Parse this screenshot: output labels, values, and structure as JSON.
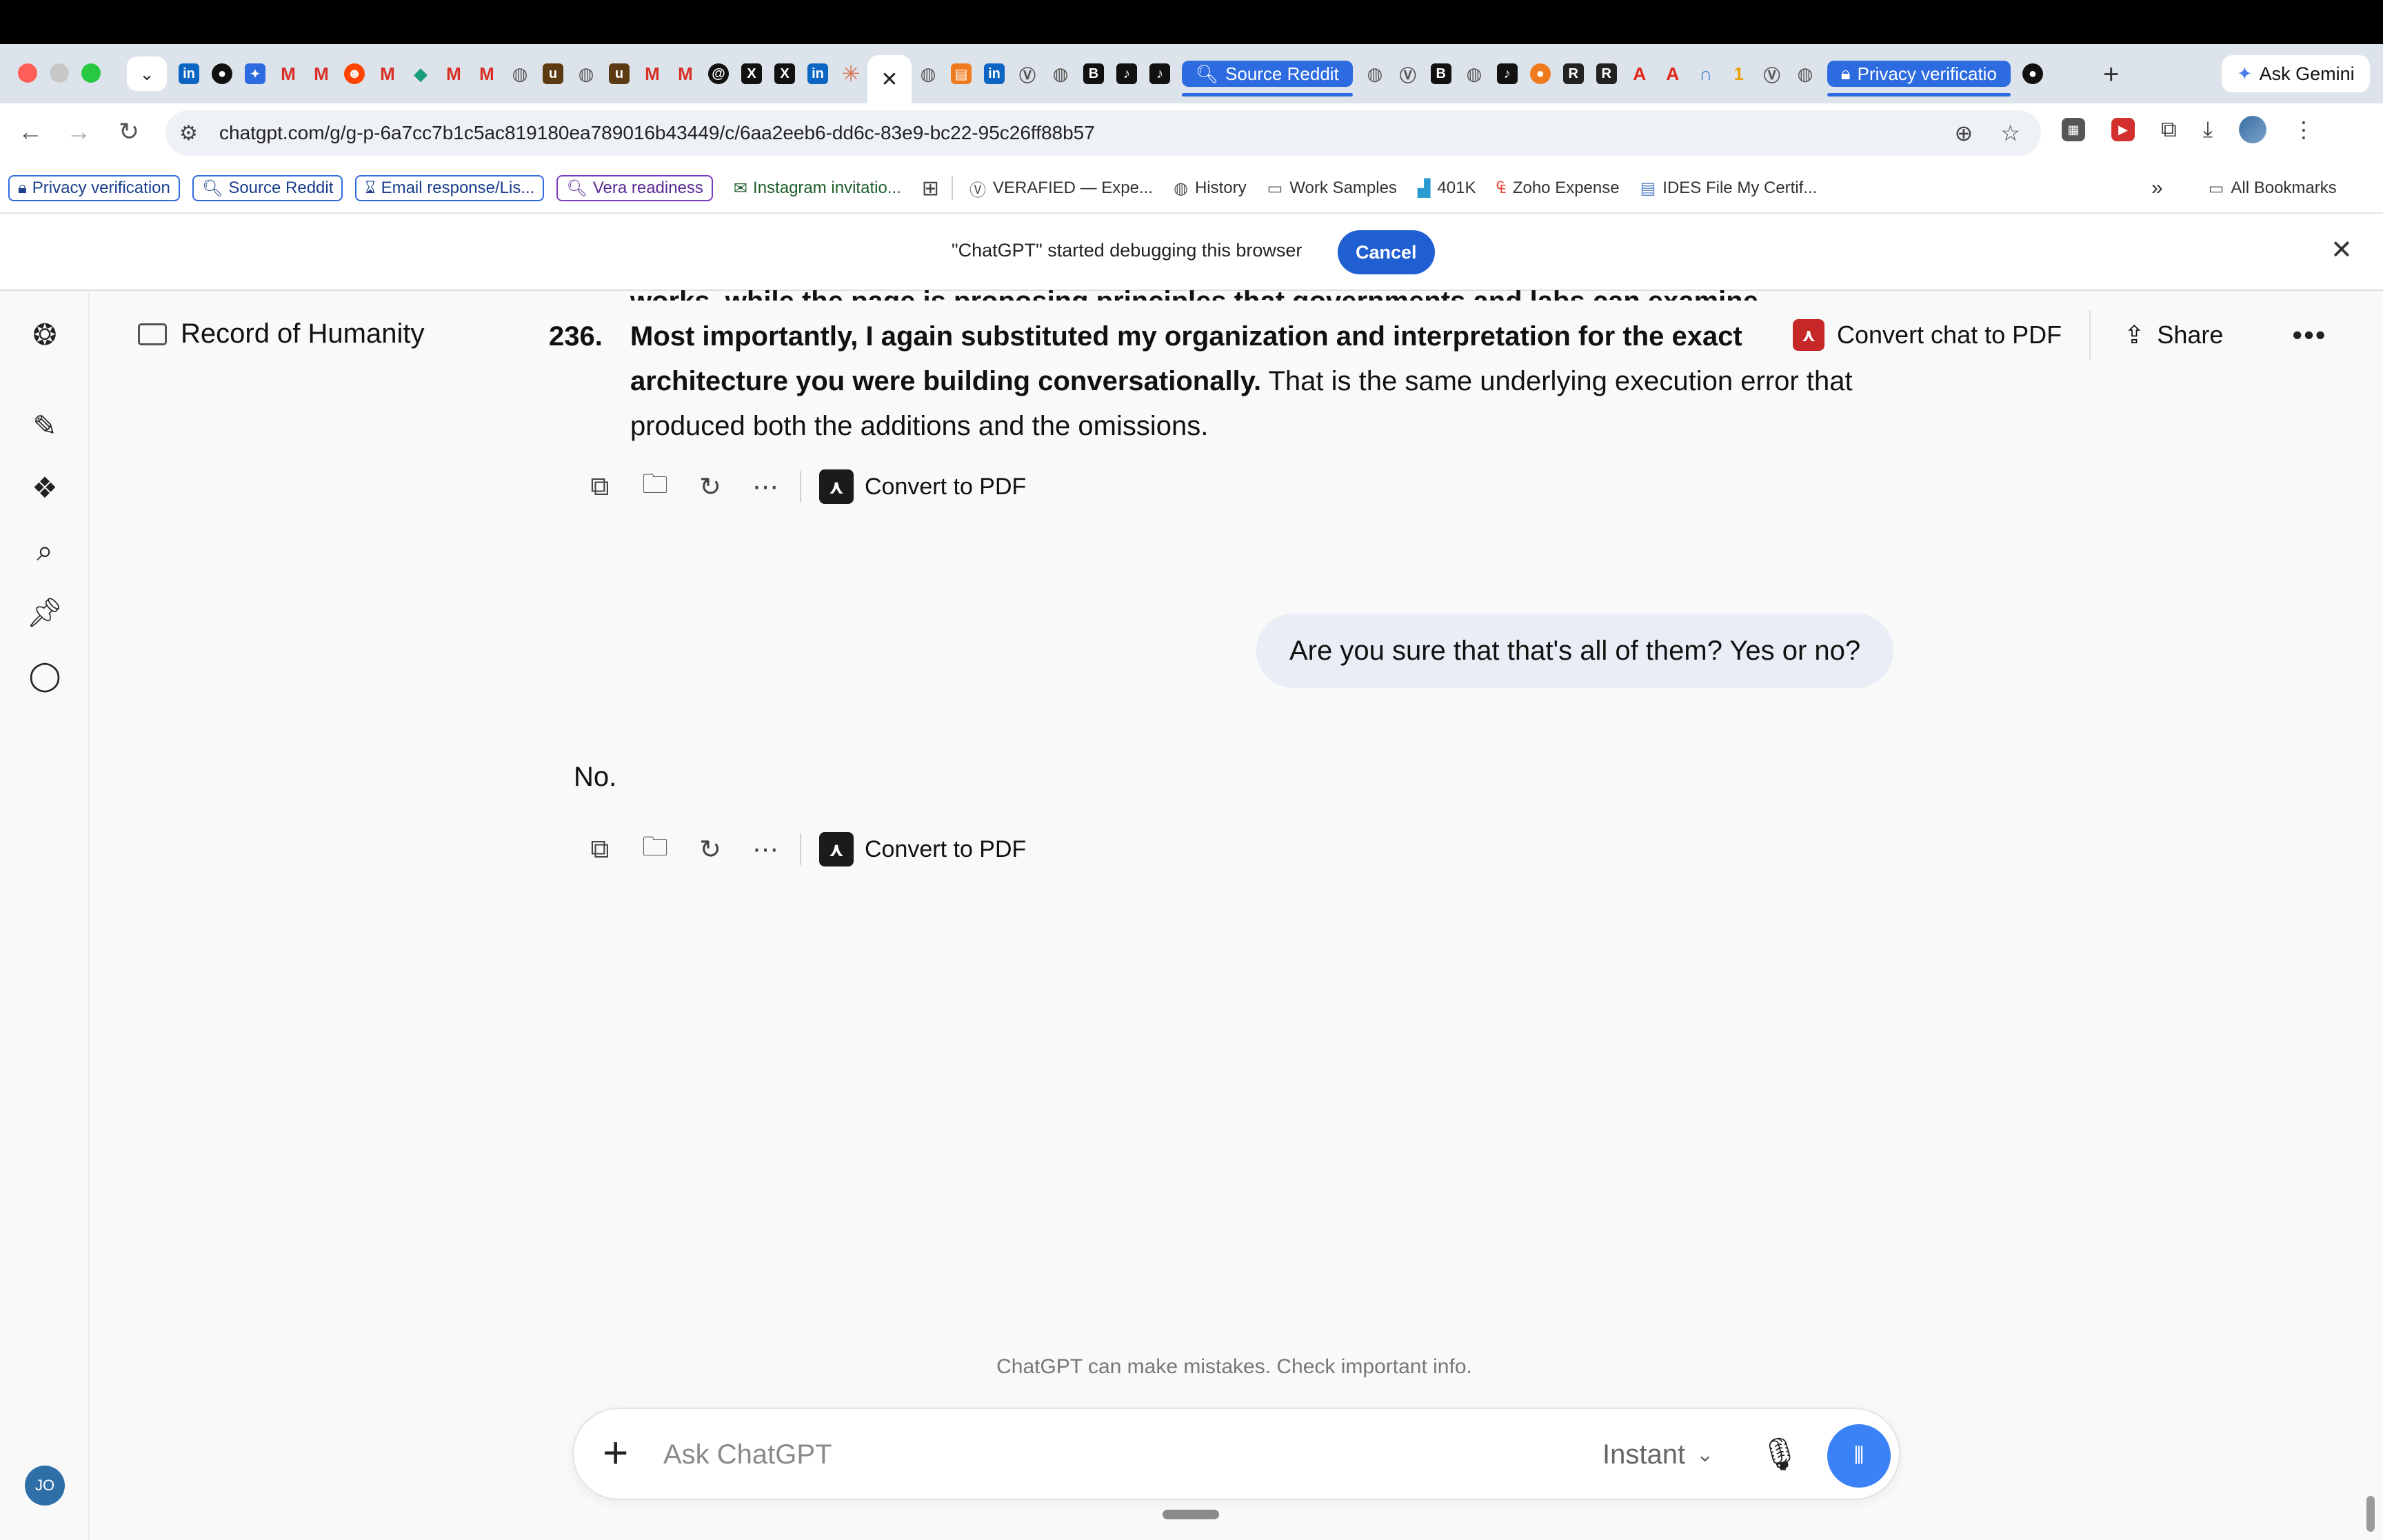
{
  "browser": {
    "tab_groups": [
      {
        "label": "Source Reddit",
        "color": "#2d6be0"
      },
      {
        "label": "Privacy verificatio",
        "color": "#2d6be0"
      }
    ],
    "ask_gemini": "Ask Gemini",
    "url": "chatgpt.com/g/g-p-6a7cc7b1c5ac819180ea789016b43449/c/6aa2eeb6-dd6c-83e9-bc22-95c26ff88b57"
  },
  "bookmarks": {
    "chips": [
      {
        "label": "Privacy verification",
        "style": "blue"
      },
      {
        "label": "Source Reddit",
        "style": "blue"
      },
      {
        "label": "Email response/Lis...",
        "style": "blue"
      },
      {
        "label": "Vera readiness",
        "style": "purple"
      },
      {
        "label": "Instagram invitatio...",
        "style": "green"
      }
    ],
    "items": [
      "VERAFIED — Expe...",
      "History",
      "Work Samples",
      "401K",
      "Zoho Expense",
      "IDES File My Certif..."
    ],
    "more": "»",
    "all_bookmarks": "All Bookmarks"
  },
  "infobar": {
    "message": "\"ChatGPT\" started debugging this browser",
    "cancel": "Cancel"
  },
  "header": {
    "project": "Record of Humanity",
    "convert_chat_pdf": "Convert chat to PDF",
    "share": "Share"
  },
  "chat": {
    "clipped_line": "works, while the page is proposing principles that governments and labs can examine.",
    "item_number": "236.",
    "item_bold": "Most importantly, I again substituted my organization and interpretation for the exact architecture you were building conversationally.",
    "item_rest": " That is the same underlying execution error that produced both the additions and the omissions.",
    "convert_pdf": "Convert to PDF",
    "user_message": "Are you sure that that's all of them? Yes or no?",
    "answer": "No."
  },
  "footer": {
    "disclaimer": "ChatGPT can make mistakes. Check important info.",
    "placeholder": "Ask ChatGPT",
    "model": "Instant"
  },
  "sidebar": {
    "user_initials": "JO"
  }
}
